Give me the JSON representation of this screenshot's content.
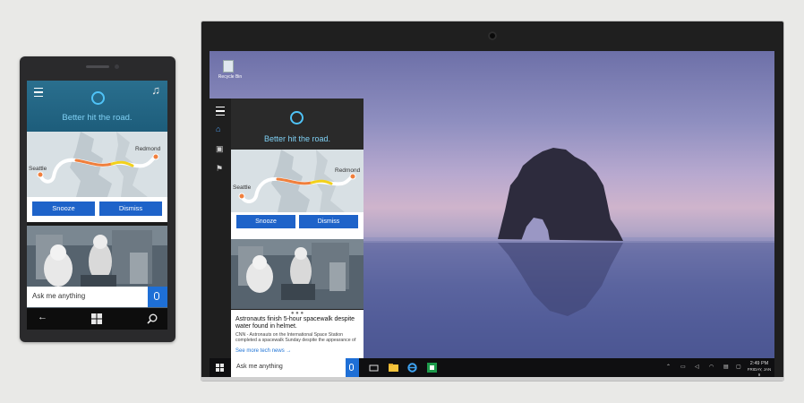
{
  "phone": {
    "greeting": "Better hit the road.",
    "card": {
      "origin": "Seattle",
      "destination": "Redmond",
      "snooze_label": "Snooze",
      "dismiss_label": "Dismiss"
    },
    "search_placeholder": "Ask me anything"
  },
  "laptop": {
    "desktop": {
      "recycle_bin_label": "Recycle Bin"
    },
    "cortana": {
      "greeting": "Better hit the road.",
      "card": {
        "origin": "Seattle",
        "destination": "Redmond",
        "snooze_label": "Snooze",
        "dismiss_label": "Dismiss"
      },
      "carousel_dots": "● ● ●",
      "news": {
        "headline": "Astronauts finish 5-hour spacewalk despite water found in helmet.",
        "summary": "CNN - Astronauts on the International Space Station completed a spacewalk Sunday despite the appearance of",
        "more_link": "See more tech news →"
      }
    },
    "taskbar": {
      "search_placeholder": "Ask me anything",
      "clock_time": "2:49 PM",
      "clock_date": "FRIDAY, JAN 9"
    }
  },
  "colors": {
    "accent_blue": "#1e63c9",
    "cortana_blue": "#4fc3f7",
    "route_orange": "#f07f3c",
    "route_yellow": "#f2d11c"
  }
}
